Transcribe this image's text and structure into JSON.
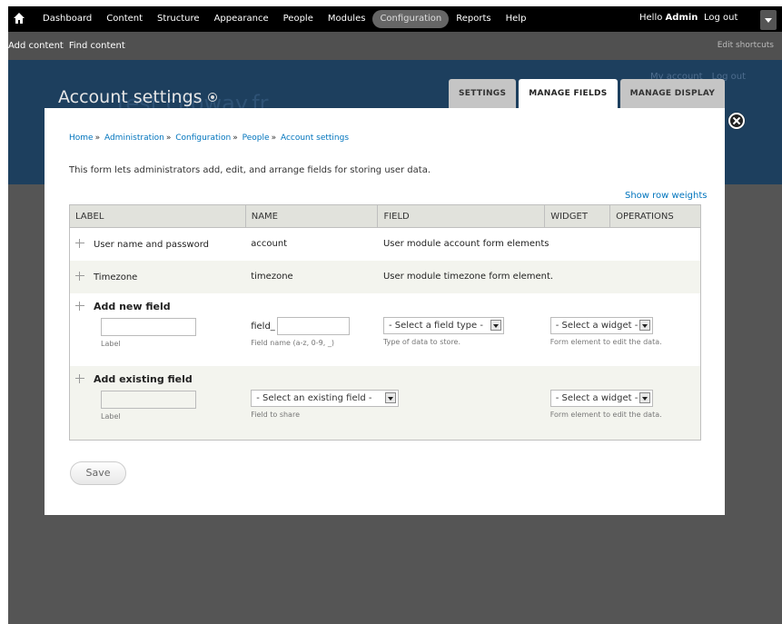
{
  "toolbar": {
    "menu": [
      "Dashboard",
      "Content",
      "Structure",
      "Appearance",
      "People",
      "Modules",
      "Configuration",
      "Reports",
      "Help"
    ],
    "active_item": "Configuration",
    "hello": "Hello",
    "user": "Admin",
    "logout": "Log out"
  },
  "shortcuts": {
    "add_content": "Add content",
    "find_content": "Find content",
    "edit_shortcuts": "Edit shortcuts"
  },
  "bg": {
    "my_account": "My account",
    "log_out": "Log out",
    "watermark": "test.clipway.fr"
  },
  "page": {
    "title": "Account settings",
    "tabs": [
      "SETTINGS",
      "MANAGE FIELDS",
      "MANAGE DISPLAY"
    ],
    "active_tab": "MANAGE FIELDS"
  },
  "breadcrumb": [
    "Home",
    "Administration",
    "Configuration",
    "People",
    "Account settings"
  ],
  "help_text": "This form lets administrators add, edit, and arrange fields for storing user data.",
  "show_row_weights": "Show row weights",
  "table": {
    "headers": [
      "LABEL",
      "NAME",
      "FIELD",
      "WIDGET",
      "OPERATIONS"
    ],
    "rows": [
      {
        "label": "User name and password",
        "name": "account",
        "field": "User module account form elements"
      },
      {
        "label": "Timezone",
        "name": "timezone",
        "field": "User module timezone form element."
      }
    ],
    "add_new": {
      "title": "Add new field",
      "label_desc": "Label",
      "name_prefix": "field_",
      "name_desc": "Field name (a-z, 0-9, _)",
      "type_select": "- Select a field type -",
      "type_desc": "Type of data to store.",
      "widget_select": "- Select a widget -",
      "widget_desc": "Form element to edit the data."
    },
    "add_existing": {
      "title": "Add existing field",
      "label_desc": "Label",
      "field_select": "- Select an existing field -",
      "field_desc": "Field to share",
      "widget_select": "- Select a widget -",
      "widget_desc": "Form element to edit the data."
    }
  },
  "save_label": "Save"
}
